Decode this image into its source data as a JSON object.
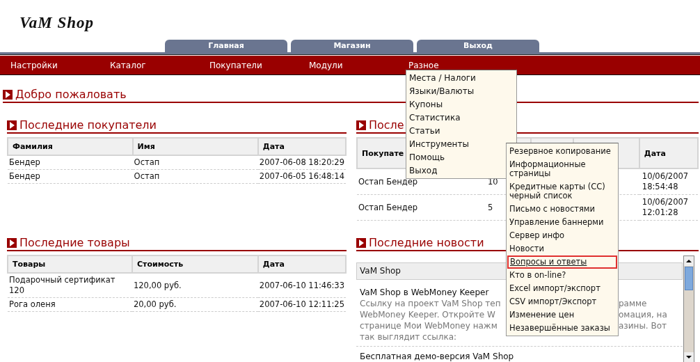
{
  "logo": "VaM Shop",
  "tabs": [
    "Главная",
    "Магазин",
    "Выход"
  ],
  "nav": [
    "Настройки",
    "Каталог",
    "Покупатели",
    "Модули",
    "Разное"
  ],
  "dropdown": [
    "Места / Налоги",
    "Языки/Валюты",
    "Купоны",
    "Статистика",
    "Статьи",
    "Инструменты",
    "Помощь",
    "Выход"
  ],
  "submenu": [
    {
      "label": "Резервное копирование",
      "selected": false
    },
    {
      "label": "Информационные страницы",
      "selected": false
    },
    {
      "label": "Кредитные карты (CC) черный список",
      "selected": false
    },
    {
      "label": "Письмо с новостями",
      "selected": false
    },
    {
      "label": "Управление баннерми",
      "selected": false
    },
    {
      "label": "Сервер инфо",
      "selected": false
    },
    {
      "label": "Новости",
      "selected": false
    },
    {
      "label": "Вопросы и ответы",
      "selected": true
    },
    {
      "label": "Кто в on-line?",
      "selected": false
    },
    {
      "label": "Excel импорт/экспорт",
      "selected": false
    },
    {
      "label": "CSV импорт/Экспорт",
      "selected": false
    },
    {
      "label": "Изменение цен",
      "selected": false
    },
    {
      "label": "Незавершённые заказы",
      "selected": false
    }
  ],
  "welcome": "Добро пожаловать",
  "customers": {
    "title": "Последние покупатели",
    "columns": [
      "Фамилия",
      "Имя",
      "Дата"
    ],
    "rows": [
      [
        "Бендер",
        "Остап",
        "2007-06-08 18:20:29"
      ],
      [
        "Бендер",
        "Остап",
        "2007-06-05 16:48:14"
      ]
    ]
  },
  "orders": {
    "title": "После",
    "header_first": "Покупате",
    "header_last": "Дата",
    "rows": [
      {
        "customer": "Остап Бендер",
        "count": "10",
        "date": "10/06/2007 18:54:48"
      },
      {
        "customer": "Остап Бендер",
        "count": "5",
        "date": "10/06/2007 12:01:28"
      }
    ]
  },
  "products": {
    "title": "Последние товары",
    "columns": [
      "Товары",
      "Стоимость",
      "Дата"
    ],
    "rows": [
      [
        "Подарочный сертификат 120",
        "120,00 руб.",
        "2007-06-10 11:46:33"
      ],
      [
        "Рога оленя",
        "20,00 руб.",
        "2007-06-10 12:11:25"
      ]
    ]
  },
  "news": {
    "title": "Последние новости",
    "header": "VaM Shop",
    "items": [
      {
        "title": "VaM Shop в WebMoney Keeper",
        "lines": [
          {
            "left": "Ссылку на проект VaM Shop теп",
            "right": "рамме"
          },
          {
            "left": "WebMoney Keeper. Откройте W",
            "right": "омация, на"
          },
          {
            "left": "странице Мои WebMoney нажм",
            "right": "азины. Вот"
          },
          {
            "left": "так выглядит ссылка:"
          }
        ]
      },
      {
        "title": "Бесплатная демо-версия VaM Shop"
      }
    ]
  }
}
